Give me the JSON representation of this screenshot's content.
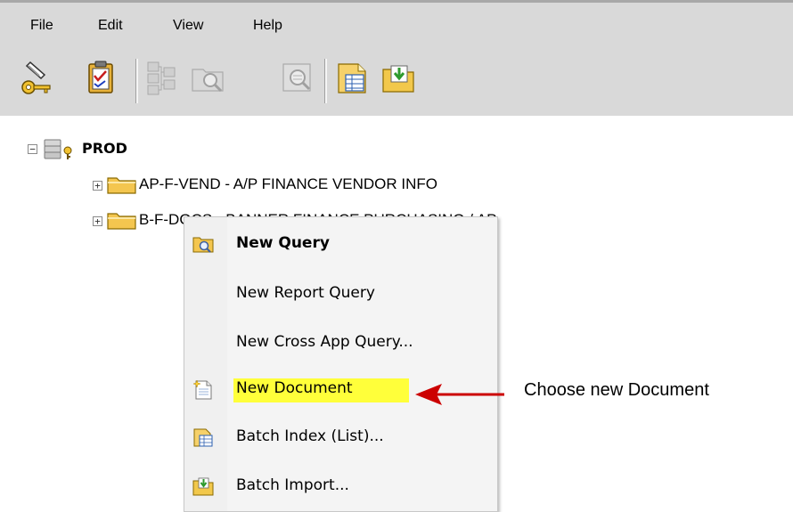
{
  "menubar": {
    "items": [
      {
        "label": "File"
      },
      {
        "label": "Edit"
      },
      {
        "label": "View"
      },
      {
        "label": "Help"
      }
    ]
  },
  "toolbar": {
    "buttons": [
      {
        "icon": "login-key-icon"
      },
      {
        "icon": "clipboard-checklist-icon"
      },
      {
        "icon": "tree-hierarchy-icon"
      },
      {
        "icon": "folder-search-icon"
      },
      {
        "icon": "document-search-icon"
      },
      {
        "icon": "document-index-icon"
      },
      {
        "icon": "folder-import-icon"
      }
    ]
  },
  "tree": {
    "root": {
      "label": "PROD",
      "expander": "−"
    },
    "children": [
      {
        "label": "AP-F-VEND - A/P FINANCE VENDOR INFO",
        "expander": "+"
      },
      {
        "label": "B-F-DOCS - BANNER FINANCE PURCHASING / AP",
        "expander": "+"
      }
    ]
  },
  "context_menu": {
    "items": [
      {
        "label": "New Query",
        "bold": true,
        "icon": "folder-search-icon"
      },
      {
        "label": "New Report Query"
      },
      {
        "label": "New Cross App Query..."
      },
      {
        "label": "New Document",
        "highlighted": true,
        "icon": "new-document-icon"
      },
      {
        "label": "Batch Index (List)...",
        "icon": "batch-index-icon"
      },
      {
        "label": "Batch Import...",
        "icon": "batch-import-icon"
      }
    ]
  },
  "annotation": {
    "text": "Choose new Document",
    "highlight_color": "#ffff3a",
    "arrow_color": "#cc0000"
  }
}
